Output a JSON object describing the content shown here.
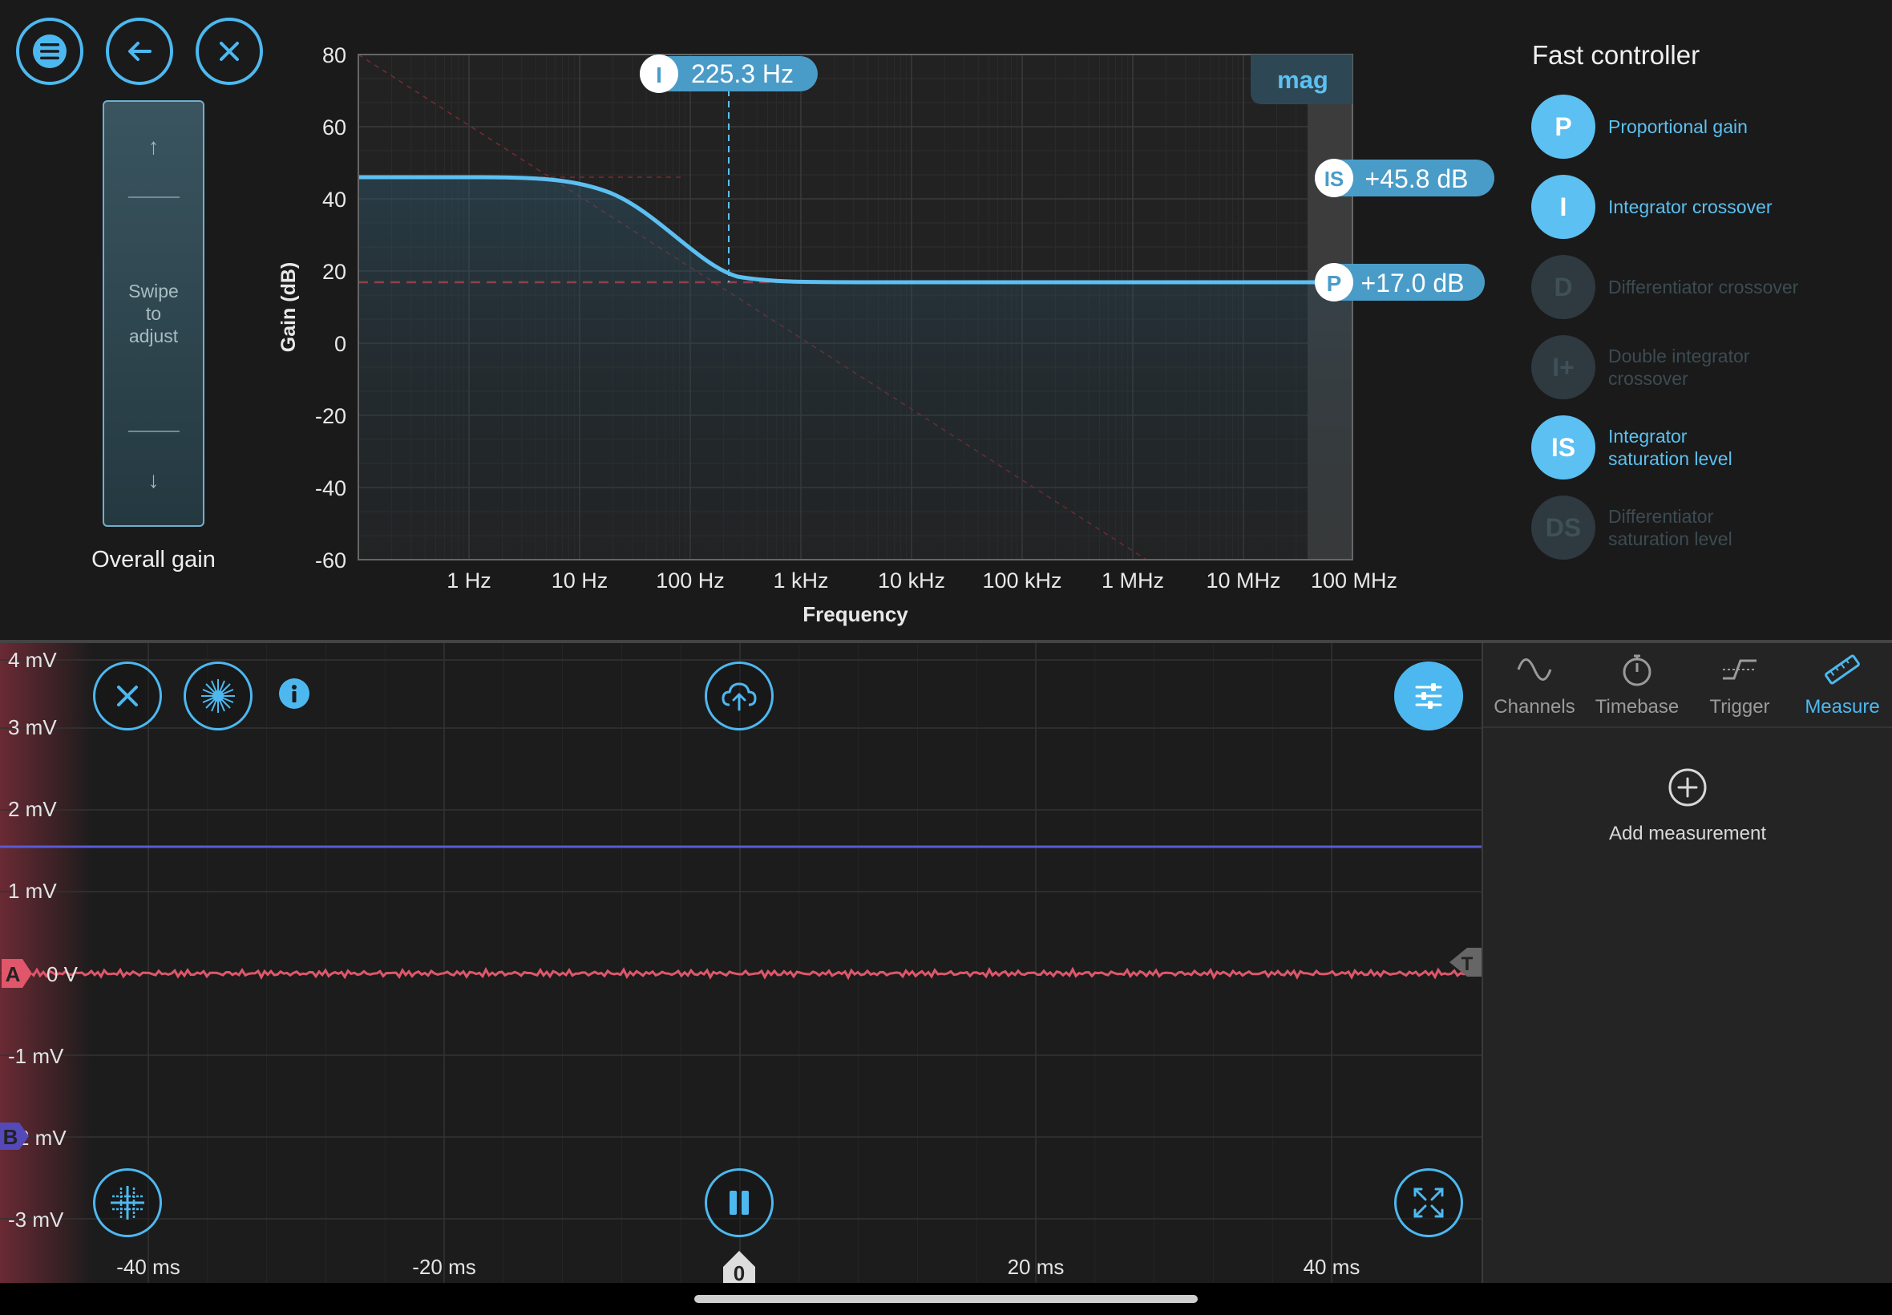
{
  "top_buttons": [
    {
      "name": "menu",
      "icon": "menu-icon"
    },
    {
      "name": "back",
      "icon": "back-arrow-icon"
    },
    {
      "name": "close",
      "icon": "close-icon"
    }
  ],
  "gain_slider": {
    "hint": "Swipe\nto\nadjust",
    "label": "Overall gain",
    "up": "↑",
    "down": "↓"
  },
  "bode": {
    "ylabel": "Gain (dB)",
    "xlabel": "Frequency",
    "yticks": [
      "80",
      "60",
      "40",
      "20",
      "0",
      "-20",
      "-40",
      "-60"
    ],
    "xticks": [
      "1 Hz",
      "10 Hz",
      "100 Hz",
      "1 kHz",
      "10 kHz",
      "100 kHz",
      "1 MHz",
      "10 MHz",
      "100 MHz"
    ],
    "mag_tab": "mag",
    "crossover_marker": {
      "symbol": "I",
      "value": "225.3 Hz"
    },
    "is_marker": {
      "symbol": "IS",
      "value": "+45.8 dB"
    },
    "p_marker": {
      "symbol": "P",
      "value": "+17.0 dB"
    },
    "curve_color": "#5cc0f2",
    "ref_color": "#d0363e"
  },
  "fast_controller": {
    "title": "Fast controller",
    "items": [
      {
        "symbol": "P",
        "label": "Proportional gain",
        "active": true
      },
      {
        "symbol": "I",
        "label": "Integrator crossover",
        "active": true
      },
      {
        "symbol": "D",
        "label": "Differentiator crossover",
        "active": false
      },
      {
        "symbol": "I+",
        "label": "Double integrator\ncrossover",
        "active": false
      },
      {
        "symbol": "IS",
        "label": "Integrator\nsaturation level",
        "active": true
      },
      {
        "symbol": "DS",
        "label": "Differentiator\nsaturation level",
        "active": false
      }
    ]
  },
  "scope": {
    "yticks": [
      "4 mV",
      "3 mV",
      "2 mV",
      "1 mV",
      "0 V",
      "-1 mV",
      "2 mV",
      "-3 mV"
    ],
    "xticks": [
      "-40 ms",
      "-20 ms",
      "0",
      "20 ms",
      "40 ms"
    ],
    "channel_a": {
      "label": "A",
      "color": "#e0566a"
    },
    "channel_b": {
      "label": "B",
      "color": "#5a5ad8"
    },
    "trigger_label": "T"
  },
  "tabs": [
    {
      "label": "Channels",
      "icon": "sine-wave-icon",
      "active": false
    },
    {
      "label": "Timebase",
      "icon": "stopwatch-icon",
      "active": false
    },
    {
      "label": "Trigger",
      "icon": "trigger-edge-icon",
      "active": false
    },
    {
      "label": "Measure",
      "icon": "ruler-icon",
      "active": true
    }
  ],
  "measure": {
    "add_label": "Add measurement"
  }
}
